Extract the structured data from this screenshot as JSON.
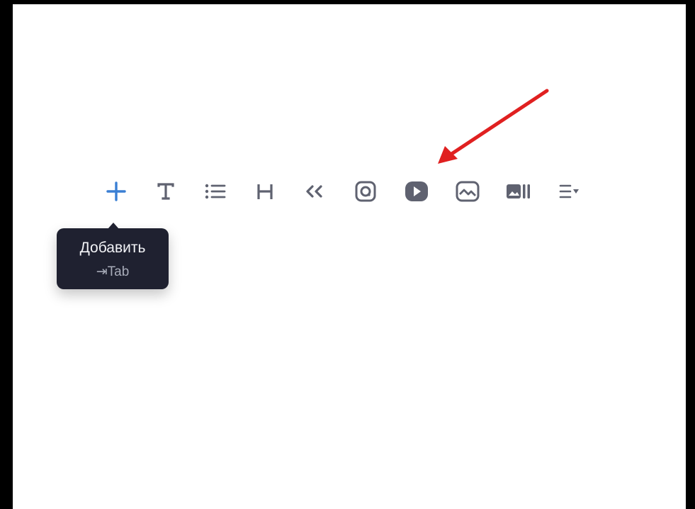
{
  "toolbar": {
    "tools": [
      {
        "id": "add",
        "icon": "plus-icon",
        "color": "#3a7fd4"
      },
      {
        "id": "text",
        "icon": "text-t-icon",
        "color": "#5f6270"
      },
      {
        "id": "list",
        "icon": "bullet-list-icon",
        "color": "#5f6270"
      },
      {
        "id": "heading",
        "icon": "heading-h-icon",
        "color": "#5f6270"
      },
      {
        "id": "quote",
        "icon": "quote-icon",
        "color": "#5f6270"
      },
      {
        "id": "instagram",
        "icon": "instagram-icon",
        "color": "#5f6270"
      },
      {
        "id": "video",
        "icon": "video-play-icon",
        "color": "#5f6270"
      },
      {
        "id": "image",
        "icon": "image-icon",
        "color": "#5f6270"
      },
      {
        "id": "gallery",
        "icon": "gallery-icon",
        "color": "#5f6270"
      },
      {
        "id": "more",
        "icon": "list-dropdown-icon",
        "color": "#5f6270"
      }
    ]
  },
  "tooltip": {
    "title": "Добавить",
    "hint": "⇥Tab"
  },
  "colors": {
    "accent": "#3a7fd4",
    "icon": "#5f6270",
    "tooltip_bg": "#1f2130",
    "annotation_arrow": "#e02020"
  }
}
